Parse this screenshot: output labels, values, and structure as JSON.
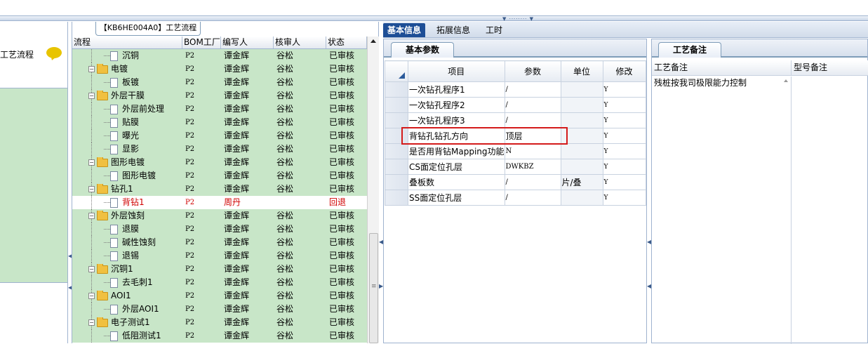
{
  "left_panel": {
    "label": "工艺流程"
  },
  "tree": {
    "title": "【KB6HE004A0】工艺流程",
    "columns": [
      "流程",
      "BOM工厂",
      "编写人",
      "核审人",
      "状态"
    ],
    "rows": [
      {
        "name": "沉铜",
        "type": "file",
        "level": 2,
        "factory": "P2",
        "writer": "谭金辉",
        "reviewer": "谷松",
        "status": "已审核",
        "selected": false
      },
      {
        "name": "电镀",
        "type": "folder",
        "level": 1,
        "factory": "P2",
        "writer": "谭金辉",
        "reviewer": "谷松",
        "status": "已审核",
        "selected": false
      },
      {
        "name": "板镀",
        "type": "file",
        "level": 2,
        "factory": "P2",
        "writer": "谭金辉",
        "reviewer": "谷松",
        "status": "已审核",
        "selected": false
      },
      {
        "name": "外层干膜",
        "type": "folder",
        "level": 1,
        "factory": "P2",
        "writer": "谭金辉",
        "reviewer": "谷松",
        "status": "已审核",
        "selected": false
      },
      {
        "name": "外层前处理",
        "type": "file",
        "level": 2,
        "factory": "P2",
        "writer": "谭金辉",
        "reviewer": "谷松",
        "status": "已审核",
        "selected": false
      },
      {
        "name": "贴膜",
        "type": "file",
        "level": 2,
        "factory": "P2",
        "writer": "谭金辉",
        "reviewer": "谷松",
        "status": "已审核",
        "selected": false
      },
      {
        "name": "曝光",
        "type": "file",
        "level": 2,
        "factory": "P2",
        "writer": "谭金辉",
        "reviewer": "谷松",
        "status": "已审核",
        "selected": false
      },
      {
        "name": "显影",
        "type": "file",
        "level": 2,
        "factory": "P2",
        "writer": "谭金辉",
        "reviewer": "谷松",
        "status": "已审核",
        "selected": false
      },
      {
        "name": "图形电镀",
        "type": "folder",
        "level": 1,
        "factory": "P2",
        "writer": "谭金辉",
        "reviewer": "谷松",
        "status": "已审核",
        "selected": false
      },
      {
        "name": "图形电镀",
        "type": "file",
        "level": 2,
        "factory": "P2",
        "writer": "谭金辉",
        "reviewer": "谷松",
        "status": "已审核",
        "selected": false
      },
      {
        "name": "钻孔1",
        "type": "folder",
        "level": 1,
        "factory": "P2",
        "writer": "谭金辉",
        "reviewer": "谷松",
        "status": "已审核",
        "selected": false
      },
      {
        "name": "背钻1",
        "type": "file",
        "level": 2,
        "factory": "P2",
        "writer": "周丹",
        "reviewer": "",
        "status": "回退",
        "selected": true
      },
      {
        "name": "外层蚀刻",
        "type": "folder",
        "level": 1,
        "factory": "P2",
        "writer": "谭金辉",
        "reviewer": "谷松",
        "status": "已审核",
        "selected": false
      },
      {
        "name": "退膜",
        "type": "file",
        "level": 2,
        "factory": "P2",
        "writer": "谭金辉",
        "reviewer": "谷松",
        "status": "已审核",
        "selected": false
      },
      {
        "name": "碱性蚀刻",
        "type": "file",
        "level": 2,
        "factory": "P2",
        "writer": "谭金辉",
        "reviewer": "谷松",
        "status": "已审核",
        "selected": false
      },
      {
        "name": "退锡",
        "type": "file",
        "level": 2,
        "factory": "P2",
        "writer": "谭金辉",
        "reviewer": "谷松",
        "status": "已审核",
        "selected": false
      },
      {
        "name": "沉铜1",
        "type": "folder",
        "level": 1,
        "factory": "P2",
        "writer": "谭金辉",
        "reviewer": "谷松",
        "status": "已审核",
        "selected": false
      },
      {
        "name": "去毛刺1",
        "type": "file",
        "level": 2,
        "factory": "P2",
        "writer": "谭金辉",
        "reviewer": "谷松",
        "status": "已审核",
        "selected": false
      },
      {
        "name": "AOI1",
        "type": "folder",
        "level": 1,
        "factory": "P2",
        "writer": "谭金辉",
        "reviewer": "谷松",
        "status": "已审核",
        "selected": false
      },
      {
        "name": "外层AOI1",
        "type": "file",
        "level": 2,
        "factory": "P2",
        "writer": "谭金辉",
        "reviewer": "谷松",
        "status": "已审核",
        "selected": false
      },
      {
        "name": "电子测试1",
        "type": "folder",
        "level": 1,
        "factory": "P2",
        "writer": "谭金辉",
        "reviewer": "谷松",
        "status": "已审核",
        "selected": false
      },
      {
        "name": "低阻测试1",
        "type": "file",
        "level": 2,
        "factory": "P2",
        "writer": "谭金辉",
        "reviewer": "谷松",
        "status": "已审核",
        "selected": false
      }
    ]
  },
  "tabs": [
    {
      "label": "基本信息",
      "active": true
    },
    {
      "label": "拓展信息",
      "active": false
    },
    {
      "label": "工时",
      "active": false
    }
  ],
  "params": {
    "subtab": "基本参数",
    "columns": [
      "项目",
      "参数",
      "单位",
      "修改"
    ],
    "rows": [
      {
        "item": "一次钻孔程序1",
        "value": "/",
        "unit": "",
        "modify": "Y"
      },
      {
        "item": "一次钻孔程序2",
        "value": "/",
        "unit": "",
        "modify": "Y"
      },
      {
        "item": "一次钻孔程序3",
        "value": "/",
        "unit": "",
        "modify": "Y"
      },
      {
        "item": "背钻孔钻孔方向",
        "value": "顶层",
        "unit": "",
        "modify": "Y"
      },
      {
        "item": "是否用背钻Mapping功能",
        "value": "N",
        "unit": "",
        "modify": "Y"
      },
      {
        "item": "CS面定位孔层",
        "value": "DWKBZ",
        "unit": "",
        "modify": "Y"
      },
      {
        "item": "叠板数",
        "value": "/",
        "unit": "片/叠",
        "modify": "Y"
      },
      {
        "item": "SS面定位孔层",
        "value": "/",
        "unit": "",
        "modify": "Y"
      }
    ]
  },
  "notes": {
    "subtab": "工艺备注",
    "columns": [
      "工艺备注",
      "型号备注"
    ],
    "process_note": "残桩按我司极限能力控制",
    "model_note": ""
  },
  "colors": {
    "accent": "#1d4e96",
    "grid_green": "#c8e6c8",
    "highlight_red": "#d41b1b"
  }
}
